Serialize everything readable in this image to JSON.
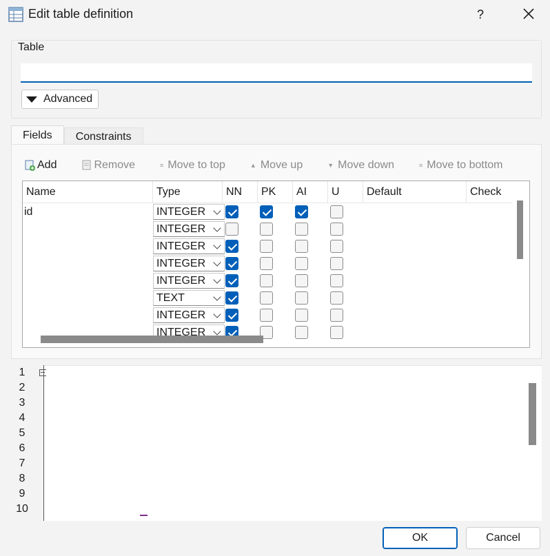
{
  "window": {
    "title": "Edit table definition",
    "help_label": "?"
  },
  "table_group": {
    "label": "Table",
    "name_value": "",
    "advanced_label": "Advanced"
  },
  "tabs": [
    {
      "label": "Fields",
      "active": true
    },
    {
      "label": "Constraints",
      "active": false
    }
  ],
  "toolbar": {
    "add_label": "Add",
    "remove_label": "Remove",
    "move_top_label": "Move to top",
    "move_up_label": "Move up",
    "move_down_label": "Move down",
    "move_bottom_label": "Move to bottom"
  },
  "grid": {
    "columns": [
      "Name",
      "Type",
      "NN",
      "PK",
      "AI",
      "U",
      "Default",
      "Check"
    ],
    "rows": [
      {
        "name": "id",
        "type": "INTEGER",
        "nn": true,
        "pk": true,
        "ai": true,
        "u": false
      },
      {
        "name": "",
        "type": "INTEGER",
        "nn": false,
        "pk": false,
        "ai": false,
        "u": false
      },
      {
        "name": "",
        "type": "INTEGER",
        "nn": true,
        "pk": false,
        "ai": false,
        "u": false
      },
      {
        "name": "",
        "type": "INTEGER",
        "nn": true,
        "pk": false,
        "ai": false,
        "u": false
      },
      {
        "name": "",
        "type": "INTEGER",
        "nn": true,
        "pk": false,
        "ai": false,
        "u": false
      },
      {
        "name": "",
        "type": "TEXT",
        "nn": true,
        "pk": false,
        "ai": false,
        "u": false
      },
      {
        "name": "",
        "type": "INTEGER",
        "nn": true,
        "pk": false,
        "ai": false,
        "u": false
      },
      {
        "name": "",
        "type": "INTEGER",
        "nn": true,
        "pk": false,
        "ai": false,
        "u": false
      }
    ]
  },
  "editor": {
    "line_numbers": [
      "1",
      "2",
      "3",
      "4",
      "5",
      "6",
      "7",
      "8",
      "9",
      "10"
    ]
  },
  "buttons": {
    "ok_label": "OK",
    "cancel_label": "Cancel"
  },
  "colors": {
    "accent": "#005fb8",
    "background": "#f3f3f3"
  }
}
